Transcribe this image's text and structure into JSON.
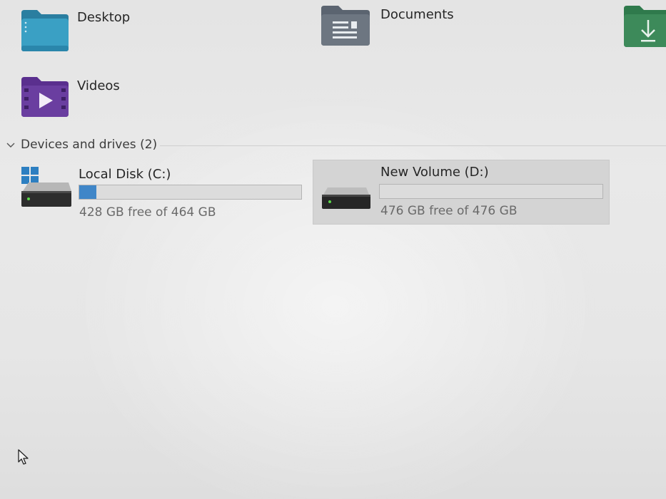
{
  "quick_access": {
    "folders": [
      {
        "label": "Desktop",
        "icon": "desktop-folder-icon"
      },
      {
        "label": "Documents",
        "icon": "documents-folder-icon"
      },
      {
        "label": "",
        "icon": "downloads-folder-icon"
      },
      {
        "label": "Videos",
        "icon": "videos-folder-icon"
      }
    ]
  },
  "devices": {
    "header": "Devices and drives (2)",
    "drives": [
      {
        "name": "Local Disk (C:)",
        "free_text": "428 GB free of 464 GB",
        "used_fraction": 0.078,
        "selected": false,
        "icon": "windows-drive-icon"
      },
      {
        "name": "New Volume (D:)",
        "free_text": "476 GB free of 476 GB",
        "used_fraction": 0.0,
        "selected": true,
        "icon": "hard-drive-icon"
      }
    ]
  },
  "colors": {
    "usage_bar_fill": "#3f86c8",
    "selection_bg": "#d4d4d4",
    "downloads_folder": "#3d8a5a",
    "videos_folder": "#6a3ea0",
    "desktop_folder": "#2f8fb3"
  }
}
